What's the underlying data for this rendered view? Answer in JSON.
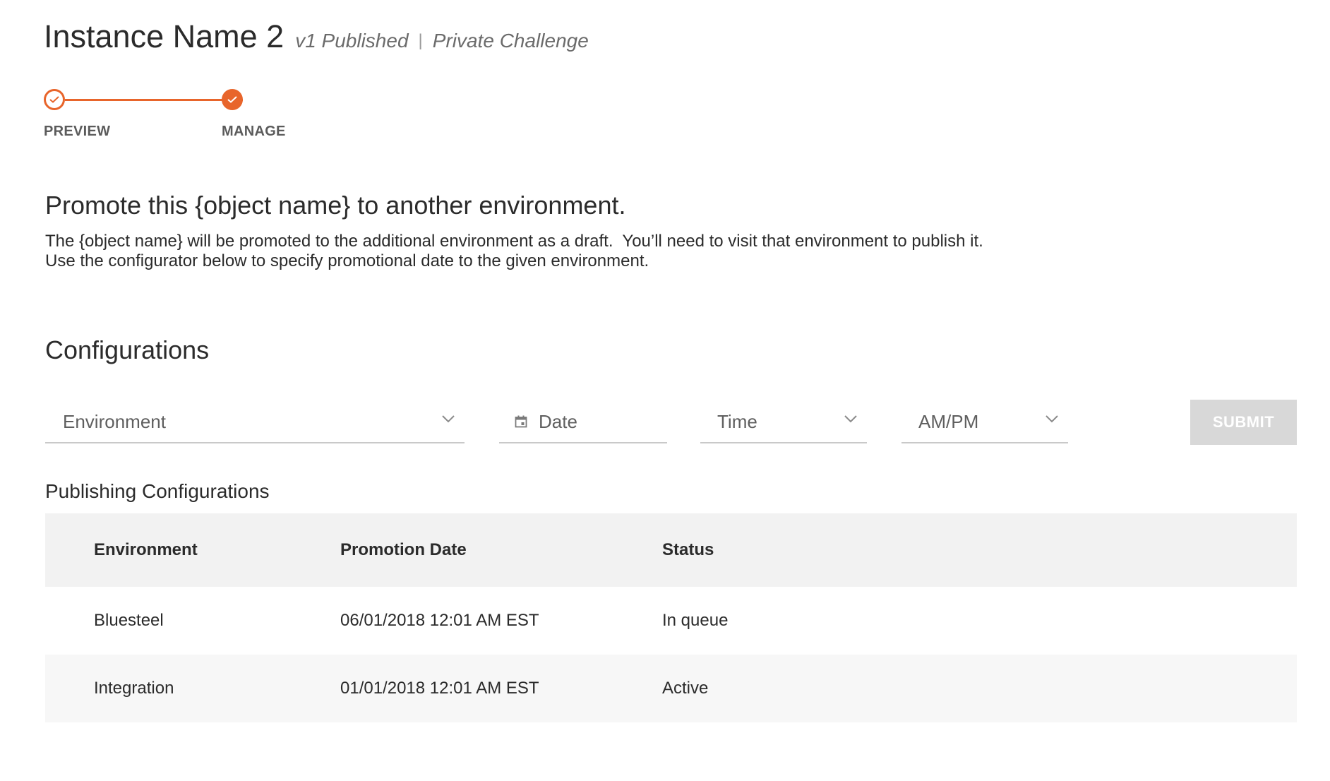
{
  "header": {
    "title": "Instance Name 2",
    "version_status": "v1 Published",
    "separator": "|",
    "challenge_type": "Private Challenge"
  },
  "stepper": {
    "steps": [
      {
        "label": "PREVIEW",
        "state": "completed"
      },
      {
        "label": "MANAGE",
        "state": "current"
      }
    ]
  },
  "promote": {
    "heading": "Promote this {object name} to another environment.",
    "description_line1": "The {object name} will be promoted to the additional environment as a draft.  You’ll need to visit that environment to publish it.",
    "description_line2": "Use the configurator below to specify promotional date to the given environment."
  },
  "configurations": {
    "heading": "Configurations",
    "environment_placeholder": "Environment",
    "date_placeholder": "Date",
    "time_placeholder": "Time",
    "ampm_placeholder": "AM/PM",
    "submit_label": "SUBMIT"
  },
  "publishing": {
    "heading": "Publishing Configurations",
    "columns": [
      "Environment",
      "Promotion Date",
      "Status"
    ],
    "rows": [
      {
        "environment": "Bluesteel",
        "promotion_date": "06/01/2018 12:01 AM EST",
        "status": "In queue"
      },
      {
        "environment": "Integration",
        "promotion_date": "01/01/2018 12:01 AM EST",
        "status": "Active"
      }
    ]
  },
  "icons": {
    "step_check": "check-icon",
    "dropdown": "chevron-down-icon",
    "date": "calendar-icon"
  },
  "colors": {
    "accent": "#e8652b",
    "submit_disabled": "#d8d8d8",
    "table_header_bg": "#f2f2f2"
  }
}
